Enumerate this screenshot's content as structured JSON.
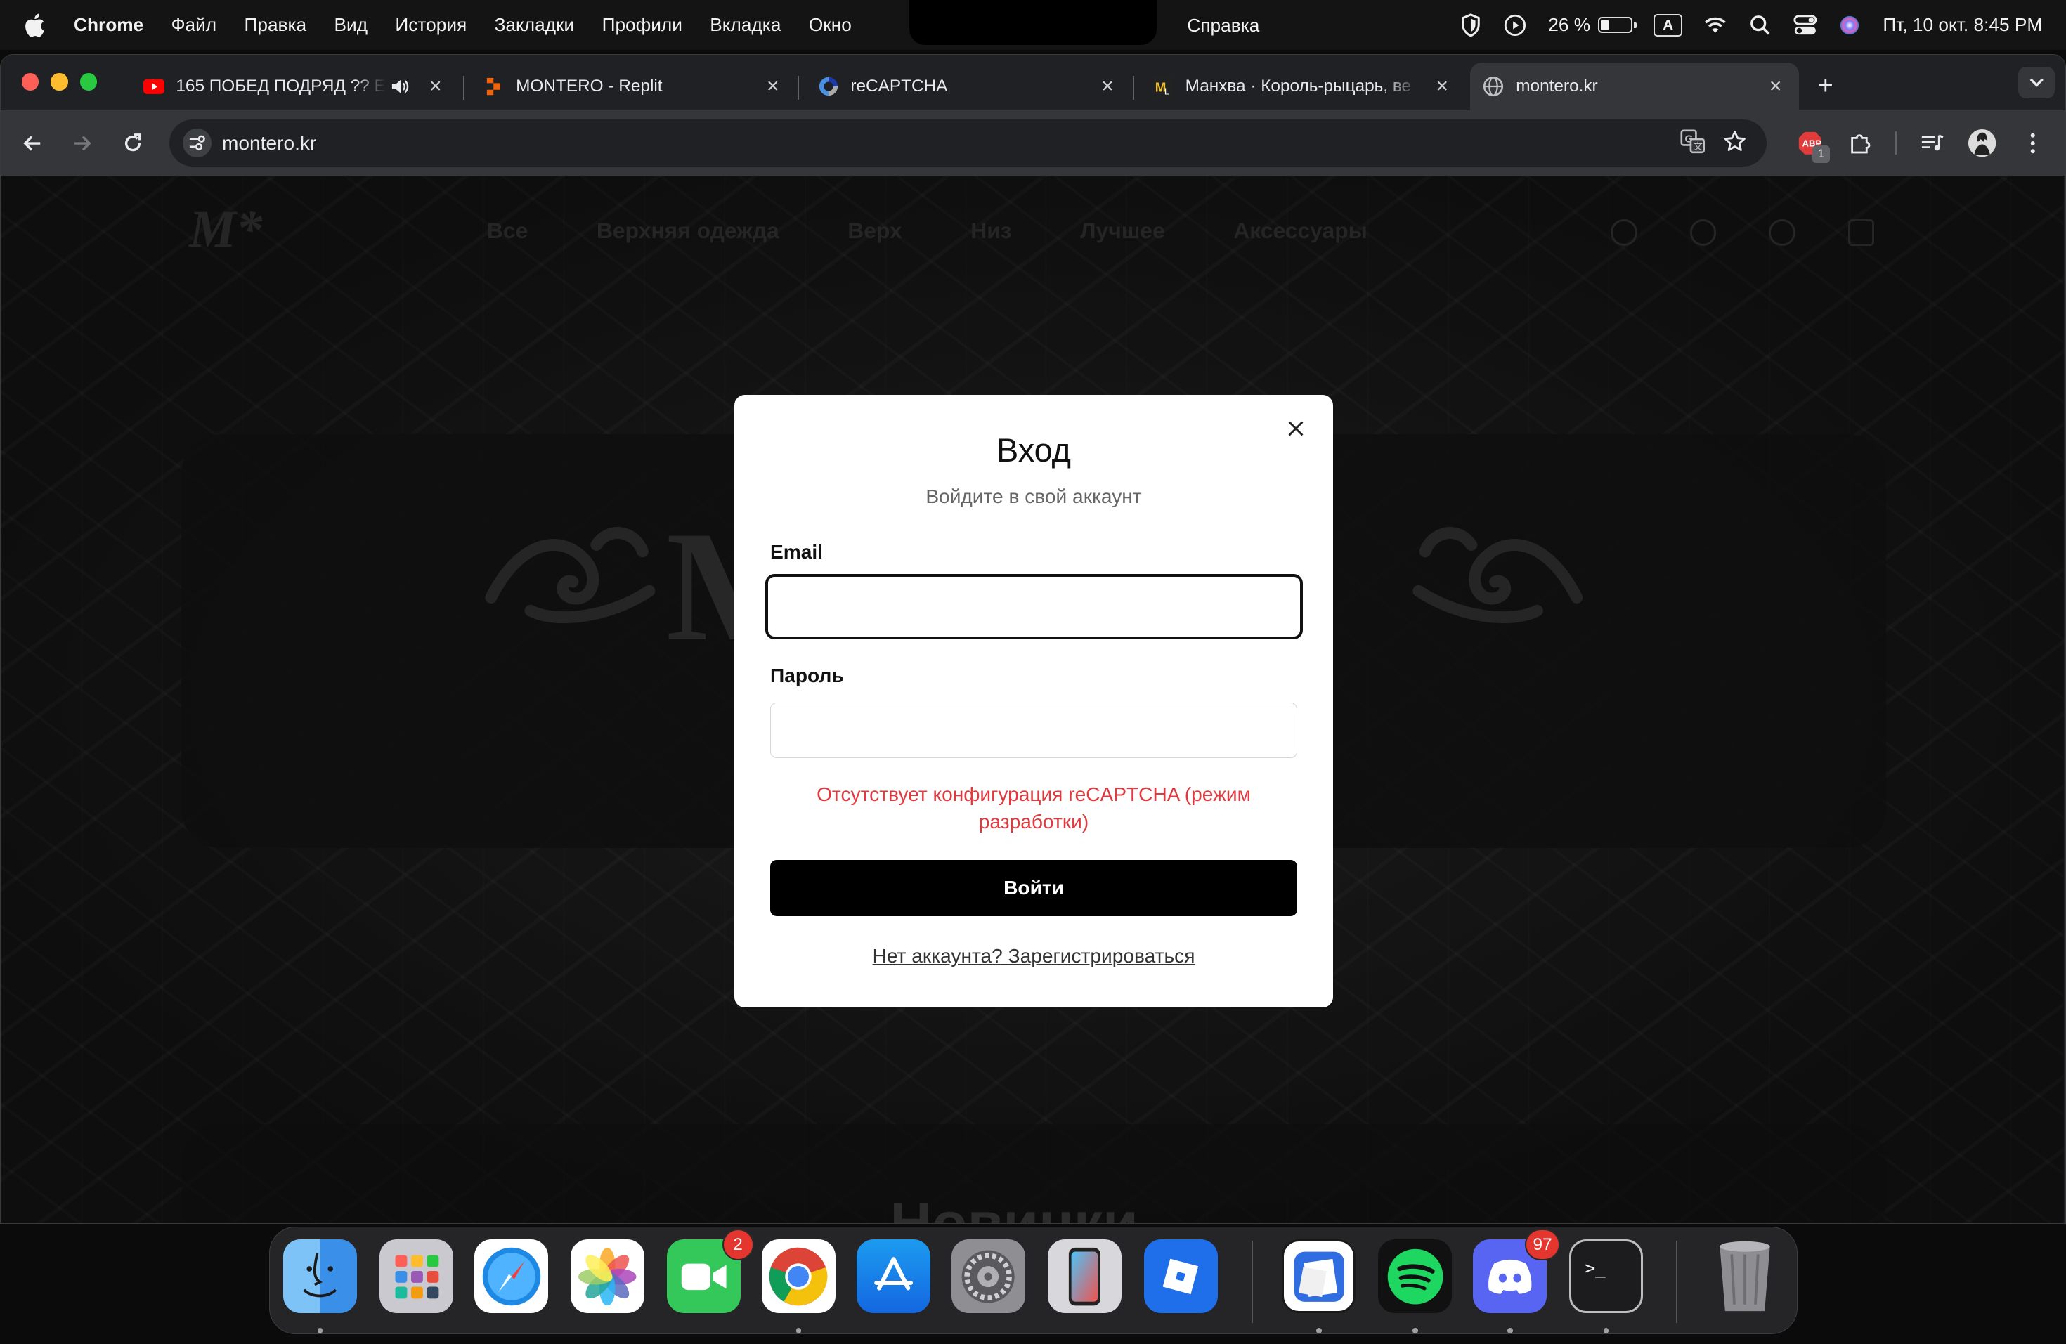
{
  "menubar": {
    "app_name": "Chrome",
    "menus": [
      "Файл",
      "Правка",
      "Вид",
      "История",
      "Закладки",
      "Профили",
      "Вкладка",
      "Окно"
    ],
    "help": "Справка",
    "battery_percent": "26 %",
    "input_source": "A",
    "datetime": "Пт, 10 окт.  8:45 PM",
    "icons": [
      "apple-icon",
      "shield-icon",
      "play-circle-icon",
      "battery-icon",
      "keyboard-input-icon",
      "wifi-icon",
      "search-icon",
      "control-center-icon",
      "siri-icon"
    ]
  },
  "browser": {
    "tabs": [
      {
        "title": "165 ПОБЕД ПОДРЯД ?? Е",
        "icon": "youtube-icon",
        "audio": true,
        "active": false
      },
      {
        "title": "MONTERO - Replit",
        "icon": "replit-icon",
        "active": false
      },
      {
        "title": "reCAPTCHA",
        "icon": "recaptcha-icon",
        "active": false
      },
      {
        "title": "Манхва · Король-рыцарь, ве",
        "icon": "manhwa-site-icon",
        "active": false
      },
      {
        "title": "montero.kr",
        "icon": "globe-icon",
        "active": true
      }
    ],
    "new_tab_label": "+",
    "url": "montero.kr",
    "extension_badge": "1"
  },
  "site": {
    "logo": "M*",
    "nav": [
      "Все",
      "Верхняя одежда",
      "Верх",
      "Низ",
      "Лучшее",
      "Аксессуары"
    ],
    "hero_word": "M      O",
    "section_title": "Новинки"
  },
  "login_modal": {
    "title": "Вход",
    "subtitle": "Войдите в свой аккаунт",
    "email_label": "Email",
    "email_value": "",
    "password_label": "Пароль",
    "password_value": "",
    "error": "Отсутствует конфигурация reCAPTCHA (режим разработки)",
    "submit_label": "Войти",
    "register_link": "Нет аккаунта? Зарегистрироваться"
  },
  "dock": {
    "apps": [
      {
        "name": "Finder",
        "icon": "finder-icon"
      },
      {
        "name": "Launchpad",
        "icon": "launchpad-icon"
      },
      {
        "name": "Safari",
        "icon": "safari-icon"
      },
      {
        "name": "Photos",
        "icon": "photos-icon"
      },
      {
        "name": "FaceTime",
        "icon": "facetime-icon",
        "badge": "2"
      },
      {
        "name": "Chrome",
        "icon": "chrome-icon"
      },
      {
        "name": "App Store",
        "icon": "app-store-icon"
      },
      {
        "name": "System Settings",
        "icon": "settings-icon"
      },
      {
        "name": "iPhone Mirroring",
        "icon": "iphone-mirroring-icon"
      },
      {
        "name": "Roblox",
        "icon": "roblox-icon"
      },
      {
        "name": "Preview",
        "icon": "preview-icon"
      },
      {
        "name": "Spotify",
        "icon": "spotify-icon"
      },
      {
        "name": "Discord",
        "icon": "discord-icon",
        "badge": "97"
      },
      {
        "name": "Terminal",
        "icon": "terminal-icon"
      },
      {
        "name": "Trash",
        "icon": "trash-icon"
      }
    ]
  },
  "colors": {
    "error_red": "#e0393e",
    "submit_bg": "#000000",
    "chrome_tab_bg": "#35363a",
    "chrome_frame": "#202124"
  }
}
